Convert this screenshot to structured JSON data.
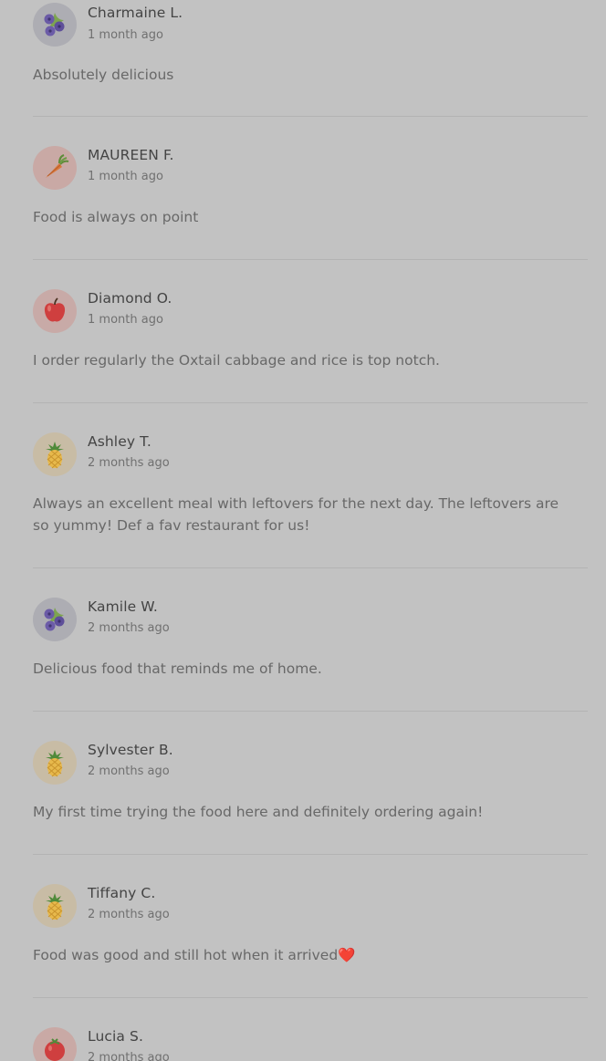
{
  "reviews": [
    {
      "name": "Charmaine L.",
      "time": "1 month ago",
      "text": "Absolutely delicious",
      "avatar_icon": "blueberry-icon",
      "avatar_bg": "#adadb3"
    },
    {
      "name": "MAUREEN F.",
      "time": "1 month ago",
      "text": "Food is always on point",
      "avatar_icon": "carrot-icon",
      "avatar_bg": "#c9a9a5"
    },
    {
      "name": "Diamond O.",
      "time": "1 month ago",
      "text": "I order regularly the Oxtail cabbage and rice is top notch.",
      "avatar_icon": "apple-icon",
      "avatar_bg": "#c8aaa7"
    },
    {
      "name": "Ashley T.",
      "time": "2 months ago",
      "text": "Always an excellent meal with leftovers for the next day. The leftovers are so yummy! Def a fav restaurant for us!",
      "avatar_icon": "pineapple-icon",
      "avatar_bg": "#c8bca5"
    },
    {
      "name": "Kamile W.",
      "time": "2 months ago",
      "text": "Delicious food that reminds me of home.",
      "avatar_icon": "blueberry-icon",
      "avatar_bg": "#adadb3"
    },
    {
      "name": "Sylvester B.",
      "time": "2 months ago",
      "text": "My first time trying the food here and definitely ordering again!",
      "avatar_icon": "pineapple-icon",
      "avatar_bg": "#c8bca5"
    },
    {
      "name": "Tiffany C.",
      "time": "2 months ago",
      "text": "Food was good and still hot when it arrived❤️",
      "avatar_icon": "pineapple-icon",
      "avatar_bg": "#c8bca5"
    },
    {
      "name": "Lucia S.",
      "time": "2 months ago",
      "text": "",
      "avatar_icon": "tomato-icon",
      "avatar_bg": "#c9a9a5"
    }
  ]
}
